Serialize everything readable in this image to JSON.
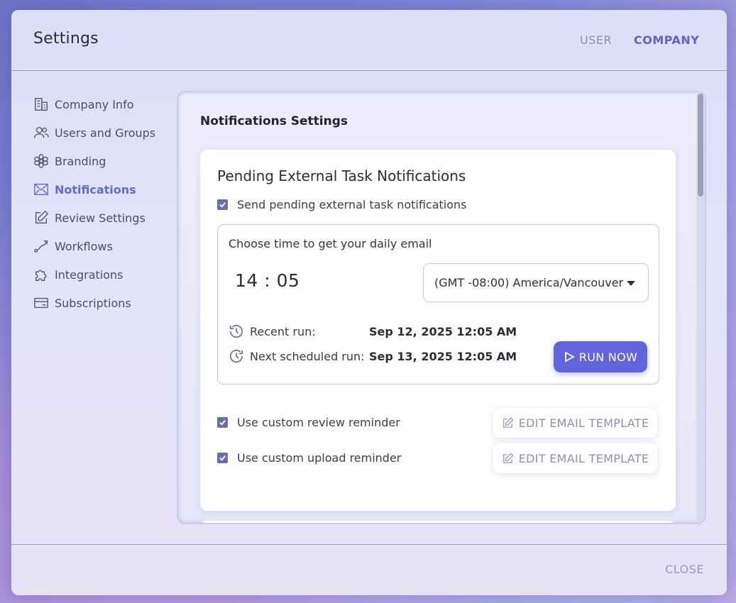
{
  "header": {
    "title": "Settings",
    "tabs": [
      {
        "label": "USER"
      },
      {
        "label": "COMPANY"
      }
    ]
  },
  "sidebar": {
    "items": [
      {
        "label": "Company Info",
        "icon": "building-icon"
      },
      {
        "label": "Users and Groups",
        "icon": "users-icon"
      },
      {
        "label": "Branding",
        "icon": "flower-icon"
      },
      {
        "label": "Notifications",
        "icon": "envelope-icon"
      },
      {
        "label": "Review Settings",
        "icon": "edit-icon"
      },
      {
        "label": "Workflows",
        "icon": "route-icon"
      },
      {
        "label": "Integrations",
        "icon": "puzzle-icon"
      },
      {
        "label": "Subscriptions",
        "icon": "credit-card-icon"
      }
    ],
    "active": "Notifications"
  },
  "panel": {
    "title": "Notifications Settings",
    "card": {
      "title": "Pending External Task Notifications",
      "send_label": "Send pending external task notifications",
      "box": {
        "label": "Choose time to get your daily email",
        "time": "14 : 05",
        "timezone": "(GMT -08:00) America/Vancouver",
        "recent_label": "Recent run:",
        "recent_value": "Sep 12, 2025 12:05 AM",
        "next_label": "Next scheduled run:",
        "next_value": "Sep 13, 2025 12:05 AM",
        "run_button": "RUN NOW"
      },
      "review_label": "Use custom review reminder",
      "upload_label": "Use custom upload reminder",
      "edit_template_label": "EDIT EMAIL TEMPLATE"
    }
  },
  "footer": {
    "close_label": "CLOSE"
  },
  "colors": {
    "accent": "#6065dc",
    "active_nav": "#6469d6",
    "checkbox": "#6b6fa8"
  }
}
